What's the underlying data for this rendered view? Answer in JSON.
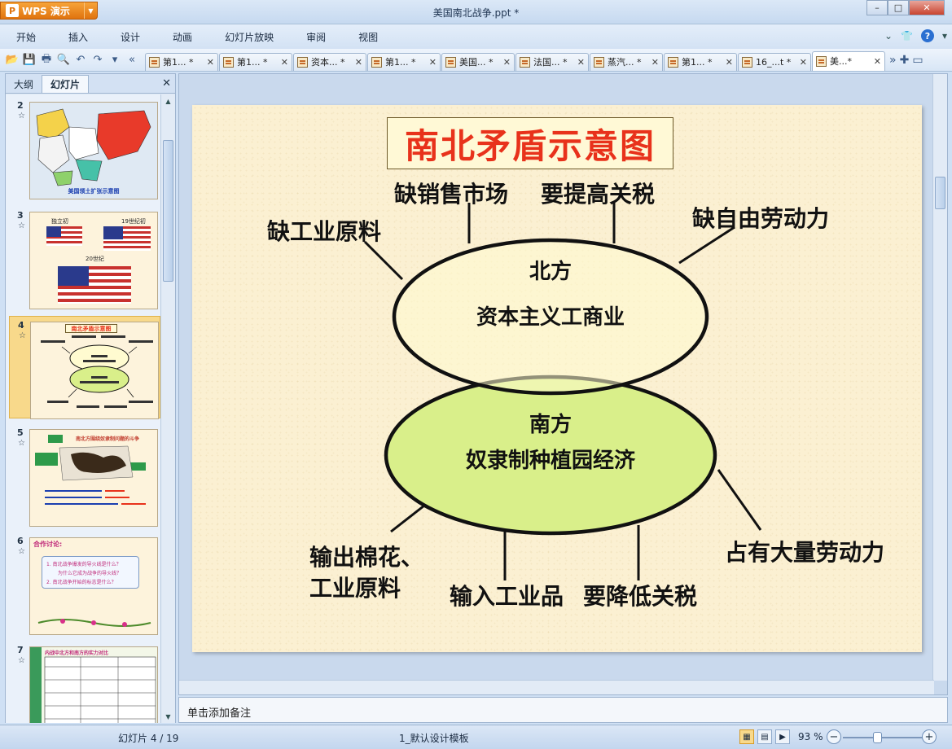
{
  "window": {
    "app_label": "WPS 演示",
    "title": "美国南北战争.ppt *"
  },
  "menu": [
    "开始",
    "插入",
    "设计",
    "动画",
    "幻灯片放映",
    "审阅",
    "视图"
  ],
  "doc_tabs": [
    {
      "label": "第1... *"
    },
    {
      "label": "第1... *"
    },
    {
      "label": "资本... *"
    },
    {
      "label": "第1... *"
    },
    {
      "label": "美国... *"
    },
    {
      "label": "法国... *"
    },
    {
      "label": "蒸汽... *"
    },
    {
      "label": "第1... *"
    },
    {
      "label": "16_...t *"
    },
    {
      "label": "美...*"
    }
  ],
  "left_panel": {
    "tab_outline": "大纲",
    "tab_slides": "幻灯片",
    "thumbnails": [
      {
        "num": "2",
        "caption": "美国领土扩张示意图"
      },
      {
        "num": "3",
        "labels": [
          "独立初",
          "19世纪初",
          "20世纪"
        ]
      },
      {
        "num": "4",
        "title": "南北矛盾示意图"
      },
      {
        "num": "5",
        "caption": "南北方围绕奴隶制问题的斗争"
      },
      {
        "num": "6",
        "heading": "合作讨论:",
        "q1": "1. 南北战争爆发的导火线是什么？",
        "q1b": "为什么它成为战争的导火线？",
        "q2": "2. 南北战争开始的标志是什么？"
      },
      {
        "num": "7",
        "heading": "内战中北方和南方的实力对比"
      }
    ]
  },
  "slide": {
    "title": "南北矛盾示意图",
    "north": {
      "name": "北方",
      "economy": "资本主义工商业"
    },
    "south": {
      "name": "南方",
      "economy": "奴隶制种植园经济"
    },
    "north_needs": [
      "缺工业原料",
      "缺销售市场",
      "要提高关税",
      "缺自由劳动力"
    ],
    "south_features": [
      "输出棉花、",
      "工业原料",
      "输入工业品",
      "要降低关税",
      "占有大量劳动力"
    ]
  },
  "notes_placeholder": "单击添加备注",
  "status": {
    "slide_counter": "幻灯片 4 / 19",
    "template": "1_默认设计模板",
    "zoom": "93 %"
  },
  "colors": {
    "title_red": "#e8321b",
    "north_fill": "#fffbd0",
    "south_fill": "#d9ef8a",
    "wps_orange": "#e0730e"
  }
}
